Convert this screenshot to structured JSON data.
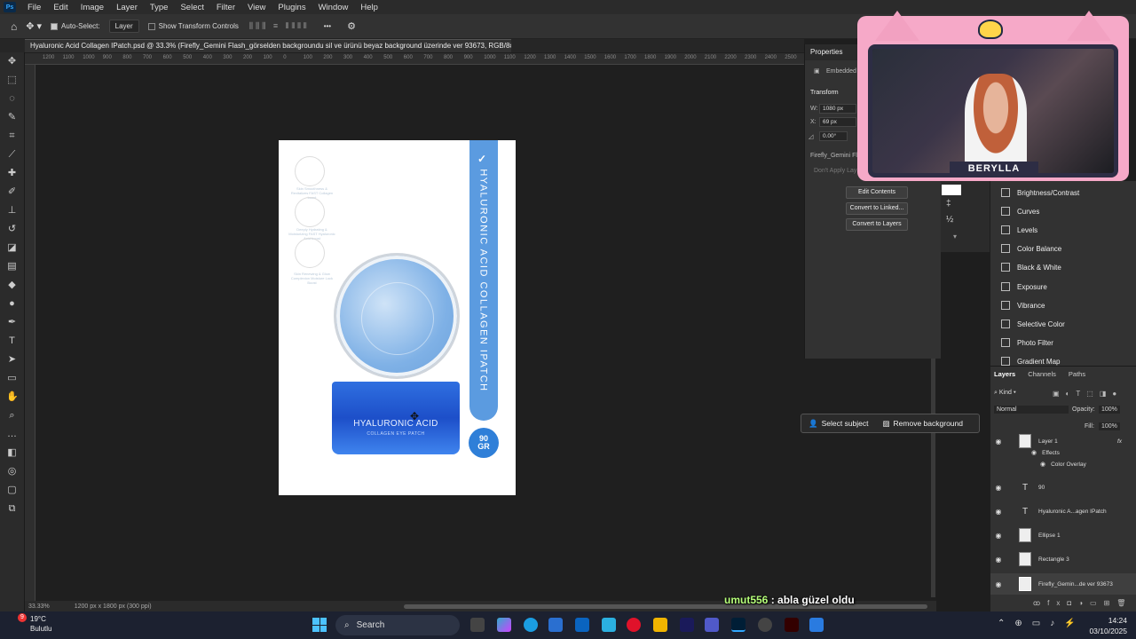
{
  "app": {
    "menu": [
      "File",
      "Edit",
      "Image",
      "Layer",
      "Type",
      "Select",
      "Filter",
      "View",
      "Plugins",
      "Window",
      "Help"
    ],
    "logo": "Ps"
  },
  "options_bar": {
    "auto_select_label": "Auto-Select:",
    "auto_select_checked": true,
    "target_value": "Layer",
    "show_transform_label": "Show Transform Controls",
    "more": "•••"
  },
  "document": {
    "tab_title": "Hyaluronic Acid Collagen IPatch.psd @ 33.3% (Firefly_Gemini Flash_görselden backgroundu sil ve ürünü beyaz background üzerinde ver 93673, RGB/8#) *",
    "ruler_ticks": [
      "1200",
      "1100",
      "1000",
      "900",
      "800",
      "700",
      "600",
      "500",
      "400",
      "300",
      "200",
      "100",
      "0",
      "100",
      "200",
      "300",
      "400",
      "500",
      "600",
      "700",
      "800",
      "900",
      "1000",
      "1100",
      "1200",
      "1300",
      "1400",
      "1500",
      "1600",
      "1700",
      "1800",
      "1900",
      "2000",
      "2100",
      "2200",
      "2300",
      "2400",
      "2500",
      "2600"
    ],
    "zoom": "33.33%",
    "doc_info": "1200 px x 1800 px (300 ppi)"
  },
  "artboard": {
    "vertical_text": "HYALURONIC ACID COLLAGEN IPATCH",
    "check": "✓",
    "badge_top": "90",
    "badge_bottom": "GR",
    "jar_title": "HYALURONIC ACID",
    "jar_subtitle": "COLLAGEN EYE PATCH",
    "ghost_labels": [
      "Skin Smoothness & Revitalizes\nFAST Collagen boost",
      "Deeply Hydrating & Moisturizing\nFAST Hyaluronic Acid boost",
      "Skin Renewing & Glow Complexion\nMoisture Lock Boost"
    ]
  },
  "properties": {
    "title": "Properties",
    "embedded_label": "Embedded",
    "transform_label": "Transform",
    "w_label": "W:",
    "w_value": "1080 px",
    "x_label": "X:",
    "x_value": "69 px",
    "angle_value": "0.00°",
    "layer_name": "Firefly_Gemini Fla",
    "dont_apply": "Don't Apply Lay",
    "buttons": [
      "Edit Contents",
      "Convert to Linked...",
      "Convert to Layers"
    ]
  },
  "adjustments": [
    "Brightness/Contrast",
    "Curves",
    "Levels",
    "Color Balance",
    "Black & White",
    "Exposure",
    "Vibrance",
    "Selective Color",
    "Photo Filter",
    "Gradient Map"
  ],
  "layers_panel": {
    "tabs": [
      "Layers",
      "Channels",
      "Paths"
    ],
    "kind": "Kind",
    "blend_mode": "Normal",
    "opacity_label": "Opacity:",
    "opacity_value": "100%",
    "fill_label": "Fill:",
    "fill_value": "100%",
    "layers": [
      {
        "name": "Layer 1",
        "type": "pixel"
      },
      {
        "name": "Effects",
        "type": "effect"
      },
      {
        "name": "Color Overlay",
        "type": "effect"
      },
      {
        "name": "90",
        "type": "text"
      },
      {
        "name": "Hyaluronic A...agen IPatch",
        "type": "text"
      },
      {
        "name": "Ellipse 1",
        "type": "pixel"
      },
      {
        "name": "Rectangle 3",
        "type": "pixel"
      },
      {
        "name": "Firefly_Gemin...de ver 93673",
        "type": "pixel"
      }
    ]
  },
  "context_bar": {
    "select_subject": "Select subject",
    "remove_background": "Remove background"
  },
  "webcam": {
    "name": "BERYLLA"
  },
  "chat": {
    "user": "umut556",
    "separator": " : ",
    "message": "abla güzel oldu"
  },
  "taskbar": {
    "badge": "9",
    "temperature": "19°C",
    "weather": "Bulutlu",
    "search": "Search",
    "time": "14:24",
    "date": "03/10/2025"
  }
}
